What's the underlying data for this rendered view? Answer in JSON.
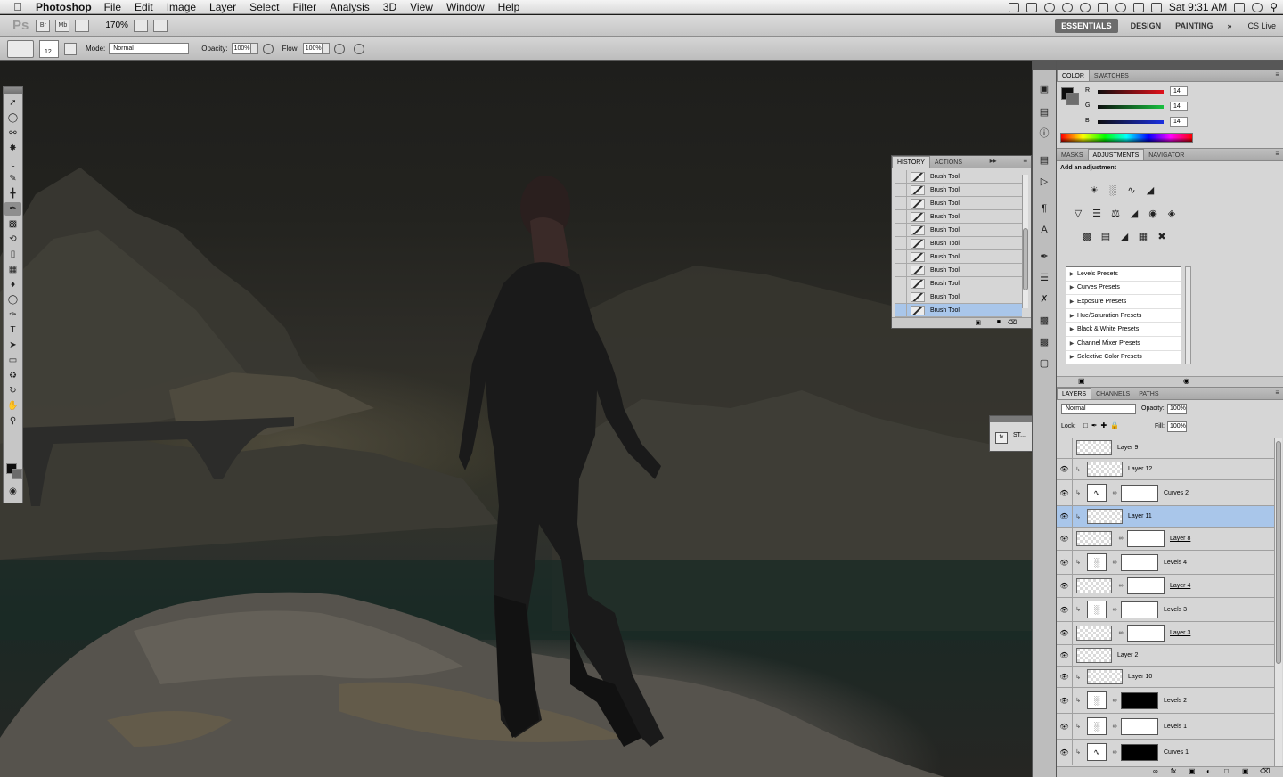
{
  "menubar": {
    "app_name": "Photoshop",
    "menus": [
      "File",
      "Edit",
      "Image",
      "Layer",
      "Select",
      "Filter",
      "Analysis",
      "3D",
      "View",
      "Window",
      "Help"
    ],
    "clock": "Sat 9:31 AM"
  },
  "appbar": {
    "logo": "Ps",
    "zoom": "170%",
    "workspaces": [
      "ESSENTIALS",
      "DESIGN",
      "PAINTING"
    ],
    "more": "»",
    "cs_live": "CS Live"
  },
  "options": {
    "brush_size": "12",
    "mode_label": "Mode:",
    "mode_value": "Normal",
    "opacity_label": "Opacity:",
    "opacity_value": "100%",
    "flow_label": "Flow:",
    "flow_value": "100%"
  },
  "history_panel": {
    "tabs": [
      "HISTORY",
      "ACTIONS"
    ],
    "items": [
      "Brush Tool",
      "Brush Tool",
      "Brush Tool",
      "Brush Tool",
      "Brush Tool",
      "Brush Tool",
      "Brush Tool",
      "Brush Tool",
      "Brush Tool",
      "Brush Tool",
      "Brush Tool"
    ],
    "active_item": "Brush Tool"
  },
  "styles_box": {
    "label": "ST..."
  },
  "color_panel": {
    "tabs": [
      "COLOR",
      "SWATCHES"
    ],
    "channels": [
      {
        "label": "R",
        "value": "14",
        "color": "#d01a1a"
      },
      {
        "label": "G",
        "value": "14",
        "color": "#19a83a"
      },
      {
        "label": "B",
        "value": "14",
        "color": "#1a2fd0"
      }
    ]
  },
  "adjustments_panel": {
    "tabs": [
      "MASKS",
      "ADJUSTMENTS",
      "NAVIGATOR"
    ],
    "heading": "Add an adjustment",
    "presets": [
      "Levels Presets",
      "Curves Presets",
      "Exposure Presets",
      "Hue/Saturation Presets",
      "Black & White Presets",
      "Channel Mixer Presets",
      "Selective Color Presets"
    ]
  },
  "layers_panel": {
    "tabs": [
      "LAYERS",
      "CHANNELS",
      "PATHS"
    ],
    "blend_mode": "Normal",
    "opacity_label": "Opacity:",
    "opacity_value": "100%",
    "lock_label": "Lock:",
    "fill_label": "Fill:",
    "fill_value": "100%",
    "layers": {
      "l9": "Layer 9",
      "l12": "Layer 12",
      "curves2": "Curves 2",
      "l11": "Layer 11",
      "l8": "Layer 8",
      "levels4": "Levels 4",
      "l4": "Layer 4",
      "levels3": "Levels 3",
      "l3": "Layer 3",
      "l2": "Layer 2",
      "l10": "Layer 10",
      "levels2": "Levels 2",
      "levels1": "Levels 1",
      "curves1": "Curves 1"
    }
  },
  "colors": {
    "selection_blue": "#a9c6ea",
    "panel_bg": "#d6d6d6",
    "canvas_dark": "#1e1e1c"
  }
}
